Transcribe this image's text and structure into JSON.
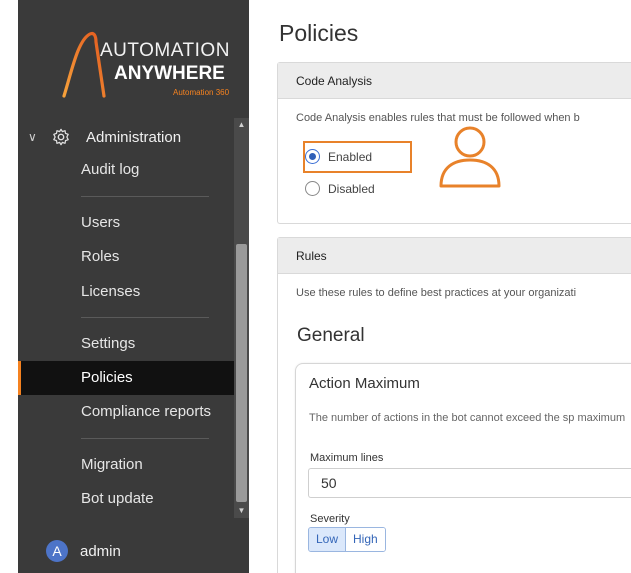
{
  "brand": {
    "line1": "AUTOMATION",
    "line2": "ANYWHERE",
    "line3": "Automation 360",
    "accent_color": "#f58220"
  },
  "sidebar": {
    "section_label": "Administration",
    "section_icon": "gear-icon",
    "items": [
      {
        "label": "Audit log"
      },
      {
        "label": "Users"
      },
      {
        "label": "Roles"
      },
      {
        "label": "Licenses"
      },
      {
        "label": "Settings"
      },
      {
        "label": "Policies",
        "active": true
      },
      {
        "label": "Compliance reports"
      },
      {
        "label": "Migration"
      },
      {
        "label": "Bot update"
      }
    ],
    "user": {
      "initial": "A",
      "name": "admin"
    }
  },
  "main": {
    "title": "Policies",
    "code_analysis": {
      "header": "Code Analysis",
      "description": "Code Analysis enables rules that must be followed when b",
      "options": [
        {
          "label": "Enabled",
          "selected": true
        },
        {
          "label": "Disabled",
          "selected": false
        }
      ]
    },
    "rules": {
      "header": "Rules",
      "description": "Use these rules to define best practices at your organizati",
      "section_title": "General",
      "rule": {
        "title": "Action Maximum",
        "description": "The number of actions in the bot cannot exceed the sp maximum",
        "field_label": "Maximum lines",
        "field_value": "50",
        "severity_label": "Severity",
        "severity_options": [
          "Low",
          "High"
        ],
        "severity_selected": "Low"
      }
    }
  },
  "colors": {
    "sidebar_bg": "#3a3a3a",
    "active_bg": "#111111",
    "highlight": "#e8822a",
    "radio_selected": "#2f5fb8"
  }
}
